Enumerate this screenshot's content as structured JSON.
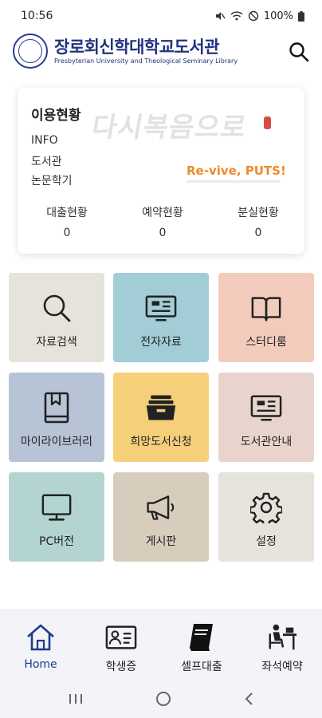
{
  "status_bar": {
    "time": "10:56",
    "battery": "100%"
  },
  "header": {
    "title": "장로회신학대학교도서관",
    "subtitle": "Presbyterian University and Theological Seminary Library"
  },
  "info_card": {
    "title": "이용현황",
    "lines": [
      "INFO",
      "도서관",
      "논문학기"
    ],
    "slogan_script": "다시복음으로",
    "slogan_tagline": "Re-vive, PUTS!",
    "stats": [
      {
        "label": "대출현황",
        "value": "0"
      },
      {
        "label": "예약현황",
        "value": "0"
      },
      {
        "label": "분실현황",
        "value": "0"
      }
    ]
  },
  "tiles": [
    {
      "label": "자료검색",
      "icon": "magnifier-icon",
      "color": "#e6e3dc"
    },
    {
      "label": "전자자료",
      "icon": "monitor-document-icon",
      "color": "#a3cdd6"
    },
    {
      "label": "스터디룸",
      "icon": "open-book-icon",
      "color": "#f2cbbd"
    },
    {
      "label": "마이라이브러리",
      "icon": "bookmark-book-icon",
      "color": "#b6c4d6"
    },
    {
      "label": "희망도서신청",
      "icon": "file-drawer-icon",
      "color": "#f6cf7a"
    },
    {
      "label": "도서관안내",
      "icon": "info-board-icon",
      "color": "#e8d4cd"
    },
    {
      "label": "PC버전",
      "icon": "desktop-monitor-icon",
      "color": "#b3d4d1"
    },
    {
      "label": "게시판",
      "icon": "megaphone-icon",
      "color": "#d8cdbd"
    },
    {
      "label": "설정",
      "icon": "gear-icon",
      "color": "#e6e3dc"
    }
  ],
  "bottom_nav": [
    {
      "label": "Home",
      "icon": "home-icon",
      "active": true
    },
    {
      "label": "학생증",
      "icon": "id-card-icon",
      "active": false
    },
    {
      "label": "셀프대출",
      "icon": "book-icon",
      "active": false
    },
    {
      "label": "좌석예약",
      "icon": "seat-desk-icon",
      "active": false
    }
  ],
  "accent_color": "#1e3c8c"
}
